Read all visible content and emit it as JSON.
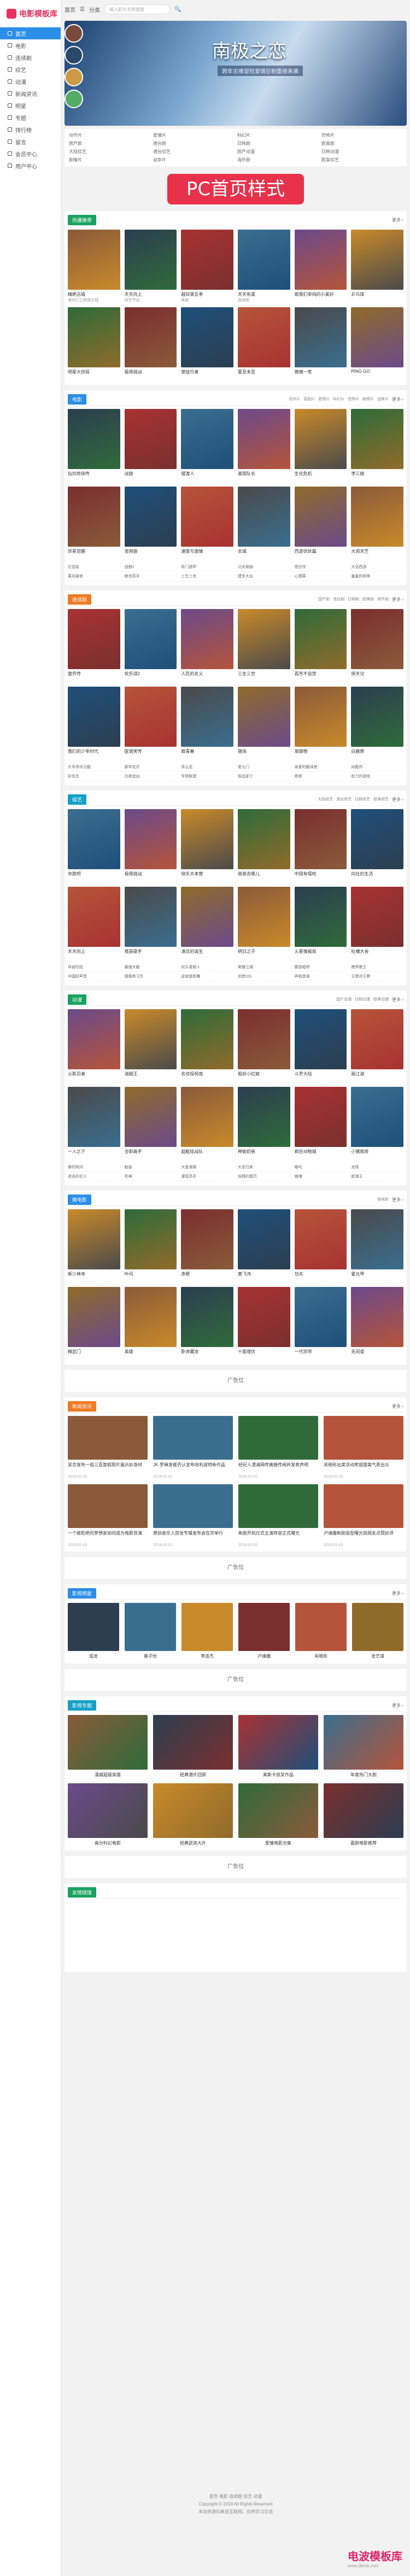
{
  "site": {
    "logo": "电影模板库"
  },
  "sidebar": {
    "items": [
      "首页",
      "电影",
      "连续剧",
      "综艺",
      "动漫",
      "新闻资讯",
      "明星",
      "专题",
      "排行榜",
      "留言",
      "会员中心",
      "用户中心"
    ]
  },
  "topbar": {
    "home": "首页",
    "cat": "分类",
    "search_placeholder": "输入影片名称搜索"
  },
  "banner": {
    "title": "南极之恋",
    "subtitle": "跨年灾难冒险爱情巨制重磅来袭"
  },
  "catbar": [
    "动作片",
    "爱情片",
    "科幻片",
    "恐怖片",
    "国产剧",
    "港台剧",
    "日韩剧",
    "欧美剧",
    "大陆综艺",
    "港台综艺",
    "国产动漫",
    "日韩动漫",
    "剧情片",
    "战争片",
    "海外剧",
    "欧美综艺"
  ],
  "pc_tag": "PC首页样式",
  "colors": {
    "accent": "#2b8ee8",
    "brand": "#e8315f",
    "sec1": "#1aa260",
    "sec2": "#2b8ee8",
    "sec3": "#f07a22",
    "sec4": "#16a0c8",
    "sec5": "#1aa260",
    "sec6": "#2b8ee8"
  },
  "sections": [
    {
      "title": "热播推荐",
      "more": "更多 ›",
      "links": [],
      "cards": [
        {
          "n": "精绝古城",
          "d": "鬼吹灯之精绝古城"
        },
        {
          "n": "天天向上",
          "d": "综艺节目"
        },
        {
          "n": "越狱第五季",
          "d": "美剧"
        },
        {
          "n": "天天有喜",
          "d": "连续剧"
        },
        {
          "n": "致我们单纯的小美好",
          "d": ""
        },
        {
          "n": "乒乓球",
          "d": ""
        },
        {
          "n": "明星大侦探",
          "d": ""
        },
        {
          "n": "极限挑战",
          "d": ""
        },
        {
          "n": "使徒行者",
          "d": ""
        },
        {
          "n": "夏至未至",
          "d": ""
        },
        {
          "n": "微微一笑",
          "d": ""
        },
        {
          "n": "PING GO",
          "d": ""
        }
      ],
      "list": []
    },
    {
      "title": "电影",
      "more": "更多 ›",
      "links": [
        "动作片",
        "喜剧片",
        "爱情片",
        "科幻片",
        "恐怖片",
        "剧情片",
        "战争片"
      ],
      "cards": [
        {
          "n": "仙剑奇侠传",
          "d": ""
        },
        {
          "n": "战狼",
          "d": ""
        },
        {
          "n": "摆渡人",
          "d": ""
        },
        {
          "n": "美国队长",
          "d": ""
        },
        {
          "n": "生化危机",
          "d": ""
        },
        {
          "n": "李三娘",
          "d": ""
        },
        {
          "n": "异星觉醒",
          "d": ""
        },
        {
          "n": "金刚狼",
          "d": ""
        },
        {
          "n": "速度与激情",
          "d": ""
        },
        {
          "n": "长城",
          "d": ""
        },
        {
          "n": "西游伏妖篇",
          "d": ""
        },
        {
          "n": "大闹天竺",
          "d": ""
        }
      ],
      "list": [
        "巨齿鲨",
        "战狼2",
        "奇门遁甲",
        "功夫瑜伽",
        "悟空传",
        "大话西游",
        "乘风破浪",
        "绝世高手",
        "三生三世",
        "建军大业",
        "心理罪",
        "羞羞的铁拳"
      ]
    },
    {
      "title": "连续剧",
      "more": "更多 ›",
      "links": [
        "国产剧",
        "港台剧",
        "日韩剧",
        "欧美剧",
        "海外剧"
      ],
      "cards": [
        {
          "n": "楚乔传",
          "d": ""
        },
        {
          "n": "欢乐颂2",
          "d": ""
        },
        {
          "n": "人民的名义",
          "d": ""
        },
        {
          "n": "三生三世",
          "d": ""
        },
        {
          "n": "孤芳不自赏",
          "d": ""
        },
        {
          "n": "择天记",
          "d": ""
        },
        {
          "n": "我们的少年时代",
          "d": ""
        },
        {
          "n": "医馆笑传",
          "d": ""
        },
        {
          "n": "致青春",
          "d": ""
        },
        {
          "n": "猎场",
          "d": ""
        },
        {
          "n": "琅琊榜",
          "d": ""
        },
        {
          "n": "白鹿原",
          "d": ""
        }
      ],
      "list": [
        "大军师司马懿",
        "那年花开",
        "青云志",
        "老九门",
        "亲爱的翻译官",
        "如懿传",
        "好先生",
        "白夜追凶",
        "军师联盟",
        "极品家丁",
        "将夜",
        "权力的游戏"
      ]
    },
    {
      "title": "综艺",
      "more": "更多 ›",
      "links": [
        "大陆综艺",
        "港台综艺",
        "日韩综艺",
        "欧美综艺"
      ],
      "cards": [
        {
          "n": "奔跑吧",
          "d": ""
        },
        {
          "n": "极限挑战",
          "d": ""
        },
        {
          "n": "快乐大本营",
          "d": ""
        },
        {
          "n": "爸爸去哪儿",
          "d": ""
        },
        {
          "n": "中国有嘻哈",
          "d": ""
        },
        {
          "n": "向往的生活",
          "d": ""
        },
        {
          "n": "天天向上",
          "d": ""
        },
        {
          "n": "我是歌手",
          "d": ""
        },
        {
          "n": "演员的诞生",
          "d": ""
        },
        {
          "n": "明日之子",
          "d": ""
        },
        {
          "n": "火星情报局",
          "d": ""
        },
        {
          "n": "吐槽大会",
          "d": ""
        }
      ],
      "list": [
        "非诚勿扰",
        "最强大脑",
        "欢乐喜剧人",
        "笑傲江湖",
        "蒙面唱将",
        "跨界歌王",
        "中国好声音",
        "偶像练习生",
        "这就是街舞",
        "创造101",
        "声临其境",
        "王牌对王牌"
      ]
    },
    {
      "title": "动漫",
      "more": "更多 ›",
      "links": [
        "国产动漫",
        "日韩动漫",
        "欧美动漫"
      ],
      "cards": [
        {
          "n": "火影忍者",
          "d": ""
        },
        {
          "n": "海贼王",
          "d": ""
        },
        {
          "n": "名侦探柯南",
          "d": ""
        },
        {
          "n": "狐妖小红娘",
          "d": ""
        },
        {
          "n": "斗罗大陆",
          "d": ""
        },
        {
          "n": "画江湖",
          "d": ""
        },
        {
          "n": "一人之下",
          "d": ""
        },
        {
          "n": "全职高手",
          "d": ""
        },
        {
          "n": "超能陆战队",
          "d": ""
        },
        {
          "n": "神偷奶爸",
          "d": ""
        },
        {
          "n": "疯狂动物城",
          "d": ""
        },
        {
          "n": "小猪佩奇",
          "d": ""
        }
      ],
      "list": [
        "秦时明月",
        "魁拔",
        "大鱼海棠",
        "大圣归来",
        "哪吒",
        "龙珠",
        "进击的巨人",
        "死神",
        "灌篮高手",
        "妖精的尾巴",
        "银魂",
        "航海王"
      ]
    },
    {
      "title": "微电影",
      "more": "更多 ›",
      "links": [
        "微电影"
      ],
      "cards": [
        {
          "n": "新少林寺",
          "d": ""
        },
        {
          "n": "叶问",
          "d": ""
        },
        {
          "n": "赤壁",
          "d": ""
        },
        {
          "n": "黄飞鸿",
          "d": ""
        },
        {
          "n": "功夫",
          "d": ""
        },
        {
          "n": "霍元甲",
          "d": ""
        },
        {
          "n": "精武门",
          "d": ""
        },
        {
          "n": "英雄",
          "d": ""
        },
        {
          "n": "卧虎藏龙",
          "d": ""
        },
        {
          "n": "十面埋伏",
          "d": ""
        },
        {
          "n": "一代宗师",
          "d": ""
        },
        {
          "n": "无间道",
          "d": ""
        }
      ],
      "list": []
    }
  ],
  "ad1": "广告位",
  "news": {
    "title": "新闻资讯",
    "more": "更多 ›",
    "items": [
      {
        "t": "吴京发布一组三亚度假照片展示好身材",
        "m": "2018-01-01"
      },
      {
        "t": "JK·罗琳发推否认宣布哈利波特新作品",
        "m": "2018-01-01"
      },
      {
        "t": "经纪人澄清网传离婚传闻并发表声明",
        "m": "2018-01-01"
      },
      {
        "t": "关晓彤出席活动笑容甜美气质出众",
        "m": "2018-01-01"
      },
      {
        "t": "一个被拒绝的梦想家如何成为电影导演",
        "m": "2018-01-01"
      },
      {
        "t": "原创音乐人首张专辑发布会在京举行",
        "m": "2018-01-01"
      },
      {
        "t": "新剧开机仪式主演阵容正式曝光",
        "m": "2018-01-01"
      },
      {
        "t": "卢靖姗新剧造型曝光获网友点赞好评",
        "m": "2018-01-01"
      }
    ]
  },
  "ad2": "广告位",
  "stars": {
    "title": "影视明星",
    "more": "更多 ›",
    "items": [
      "成龙",
      "章子怡",
      "李连杰",
      "卢靖姗",
      "关晓彤",
      "张艺谋"
    ]
  },
  "ad3": "广告位",
  "topics": {
    "title": "影视专题",
    "more": "更多 ›",
    "items": [
      "漫威超级英雄",
      "经典港片回顾",
      "奥斯卡获奖作品",
      "年度热门大剧",
      "高分科幻电影",
      "经典武侠大片",
      "爱情电影合集",
      "喜剧电影推荐"
    ]
  },
  "ad4": "广告位",
  "friend_links": {
    "title": "友情链接"
  },
  "footer": {
    "l1": "首页  电影  连续剧  综艺  动漫",
    "l2": "Copyright © 2018 All Rights Reserved",
    "l3": "本站资源均来自互联网，仅供学习交流"
  },
  "watermark": {
    "main": "电波模板库",
    "sub": "www.dbmb.com"
  }
}
